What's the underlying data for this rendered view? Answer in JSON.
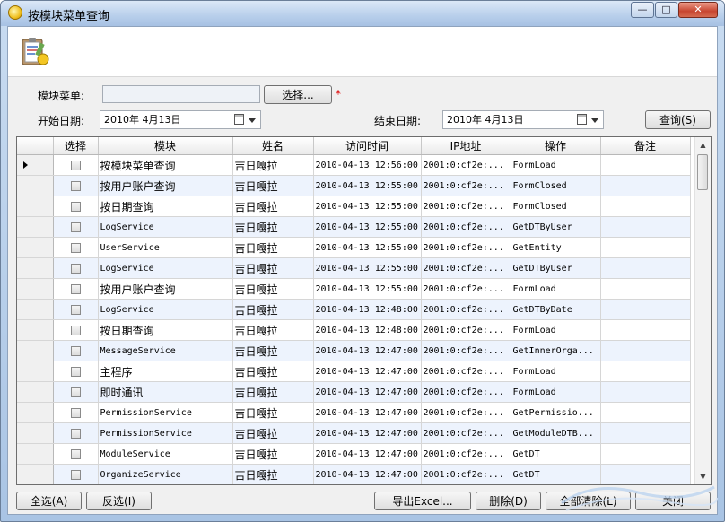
{
  "window": {
    "title": "按模块菜单查询"
  },
  "filters": {
    "module_label": "模块菜单:",
    "module_value": "",
    "select_button": "选择...",
    "required_mark": "*",
    "start_label": "开始日期:",
    "start_date": "2010年  4月13日",
    "end_label": "结束日期:",
    "end_date": "2010年  4月13日",
    "query_button": "查询(S)"
  },
  "grid": {
    "columns": [
      "选择",
      "模块",
      "姓名",
      "访问时间",
      "IP地址",
      "操作",
      "备注"
    ],
    "rows": [
      [
        "按模块菜单查询",
        "吉日嘎拉",
        "2010-04-13 12:56:00",
        "2001:0:cf2e:...",
        "FormLoad",
        ""
      ],
      [
        "按用户账户查询",
        "吉日嘎拉",
        "2010-04-13 12:55:00",
        "2001:0:cf2e:...",
        "FormClosed",
        ""
      ],
      [
        "按日期查询",
        "吉日嘎拉",
        "2010-04-13 12:55:00",
        "2001:0:cf2e:...",
        "FormClosed",
        ""
      ],
      [
        "LogService",
        "吉日嘎拉",
        "2010-04-13 12:55:00",
        "2001:0:cf2e:...",
        "GetDTByUser",
        ""
      ],
      [
        "UserService",
        "吉日嘎拉",
        "2010-04-13 12:55:00",
        "2001:0:cf2e:...",
        "GetEntity",
        ""
      ],
      [
        "LogService",
        "吉日嘎拉",
        "2010-04-13 12:55:00",
        "2001:0:cf2e:...",
        "GetDTByUser",
        ""
      ],
      [
        "按用户账户查询",
        "吉日嘎拉",
        "2010-04-13 12:55:00",
        "2001:0:cf2e:...",
        "FormLoad",
        ""
      ],
      [
        "LogService",
        "吉日嘎拉",
        "2010-04-13 12:48:00",
        "2001:0:cf2e:...",
        "GetDTByDate",
        ""
      ],
      [
        "按日期查询",
        "吉日嘎拉",
        "2010-04-13 12:48:00",
        "2001:0:cf2e:...",
        "FormLoad",
        ""
      ],
      [
        "MessageService",
        "吉日嘎拉",
        "2010-04-13 12:47:00",
        "2001:0:cf2e:...",
        "GetInnerOrga...",
        ""
      ],
      [
        "主程序",
        "吉日嘎拉",
        "2010-04-13 12:47:00",
        "2001:0:cf2e:...",
        "FormLoad",
        ""
      ],
      [
        "即时通讯",
        "吉日嘎拉",
        "2010-04-13 12:47:00",
        "2001:0:cf2e:...",
        "FormLoad",
        ""
      ],
      [
        "PermissionService",
        "吉日嘎拉",
        "2010-04-13 12:47:00",
        "2001:0:cf2e:...",
        "GetPermissio...",
        ""
      ],
      [
        "PermissionService",
        "吉日嘎拉",
        "2010-04-13 12:47:00",
        "2001:0:cf2e:...",
        "GetModuleDTB...",
        ""
      ],
      [
        "ModuleService",
        "吉日嘎拉",
        "2010-04-13 12:47:00",
        "2001:0:cf2e:...",
        "GetDT",
        ""
      ],
      [
        "OrganizeService",
        "吉日嘎拉",
        "2010-04-13 12:47:00",
        "2001:0:cf2e:...",
        "GetDT",
        ""
      ]
    ]
  },
  "footer": {
    "select_all": "全选(A)",
    "invert": "反选(I)",
    "export": "导出Excel...",
    "delete": "删除(D)",
    "clear_all": "全部清除(L)",
    "close": "关闭"
  }
}
